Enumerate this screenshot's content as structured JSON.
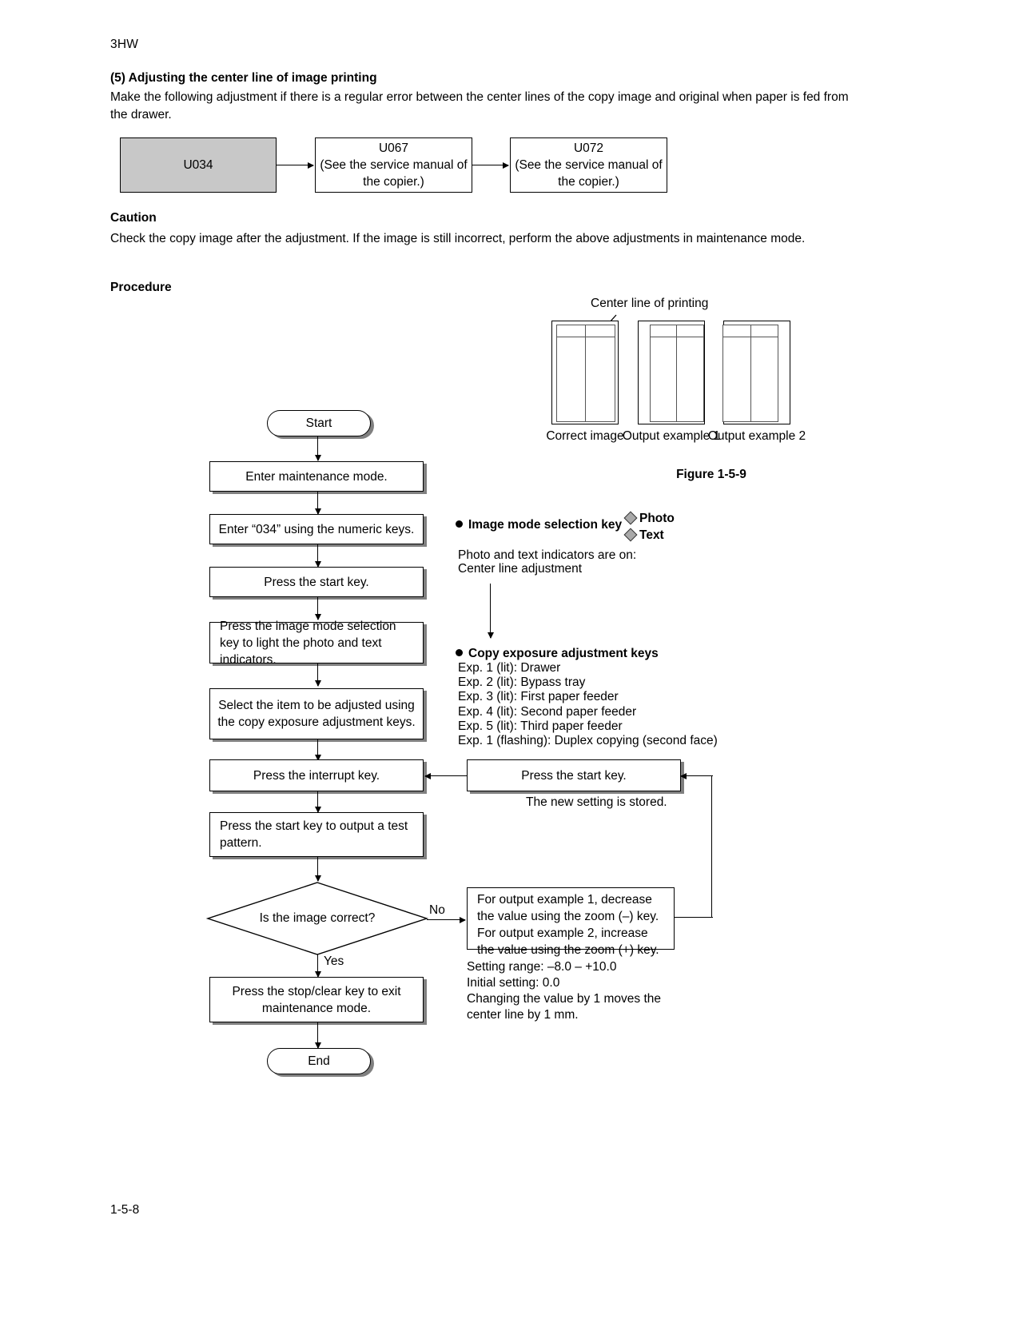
{
  "document": {
    "code": "3HW",
    "footer": "1-5-8"
  },
  "section": {
    "heading": "(5) Adjusting the center line of image printing",
    "intro": "Make the following adjustment if there is a regular error between the center lines of the copy image and original when paper is fed from the drawer.",
    "caution_heading": "Caution",
    "caution_text": "Check the copy image after the adjustment. If the image is still incorrect, perform the above adjustments in maintenance mode.",
    "procedure_heading": "Procedure"
  },
  "ucode_flow": [
    {
      "code": "U034",
      "note": "",
      "shaded": true
    },
    {
      "code": "U067",
      "note": "(See the service manual of the copier.)",
      "shaded": false
    },
    {
      "code": "U072",
      "note": "(See the service manual of the copier.)",
      "shaded": false
    }
  ],
  "figure": {
    "center_line_label": "Center line of printing",
    "captions": [
      "Correct image",
      "Output example 1",
      "Output example 2"
    ],
    "label": "Figure 1-5-9"
  },
  "flowchart": {
    "start": "Start",
    "end": "End",
    "steps": [
      "Enter maintenance mode.",
      "Enter “034” using the numeric keys.",
      "Press the start key.",
      "Press the image mode selection key to light the photo and text indicators.",
      "Select the item to be adjusted using the copy exposure adjustment keys.",
      "Press the interrupt key.",
      "Press the start key to output a test pattern."
    ],
    "decision": "Is the image correct?",
    "branch_no": "No",
    "branch_yes": "Yes",
    "store_box": "Press the start key.",
    "store_note": "The new setting is stored.",
    "adjust_box": "For output example 1, decrease the value using the zoom (–) key. For output example 2, increase the value using the zoom (+) key.",
    "exit_box": "Press the stop/clear key to exit maintenance mode."
  },
  "annotations": {
    "image_mode": {
      "heading": "Image mode selection key",
      "indicators": [
        "Photo",
        "Text"
      ],
      "note_line1": "Photo and text indicators are on:",
      "note_line2": "Center line adjustment"
    },
    "exposure": {
      "heading": "Copy exposure adjustment keys",
      "items": [
        "Exp. 1 (lit): Drawer",
        "Exp. 2 (lit): Bypass tray",
        "Exp. 3 (lit): First paper feeder",
        "Exp. 4 (lit): Second paper feeder",
        "Exp. 5 (lit): Third paper feeder",
        "Exp. 1 (flashing): Duplex copying (second face)"
      ]
    },
    "settings": {
      "range": "Setting range: –8.0 – +10.0",
      "initial": "Initial setting: 0.0",
      "note_line1": "Changing the value by 1 moves the",
      "note_line2": "center line by 1 mm."
    }
  },
  "colors": {
    "shaded_box": "#c8c8c8",
    "line": "#000000",
    "indicator": "#a9a9a9"
  }
}
